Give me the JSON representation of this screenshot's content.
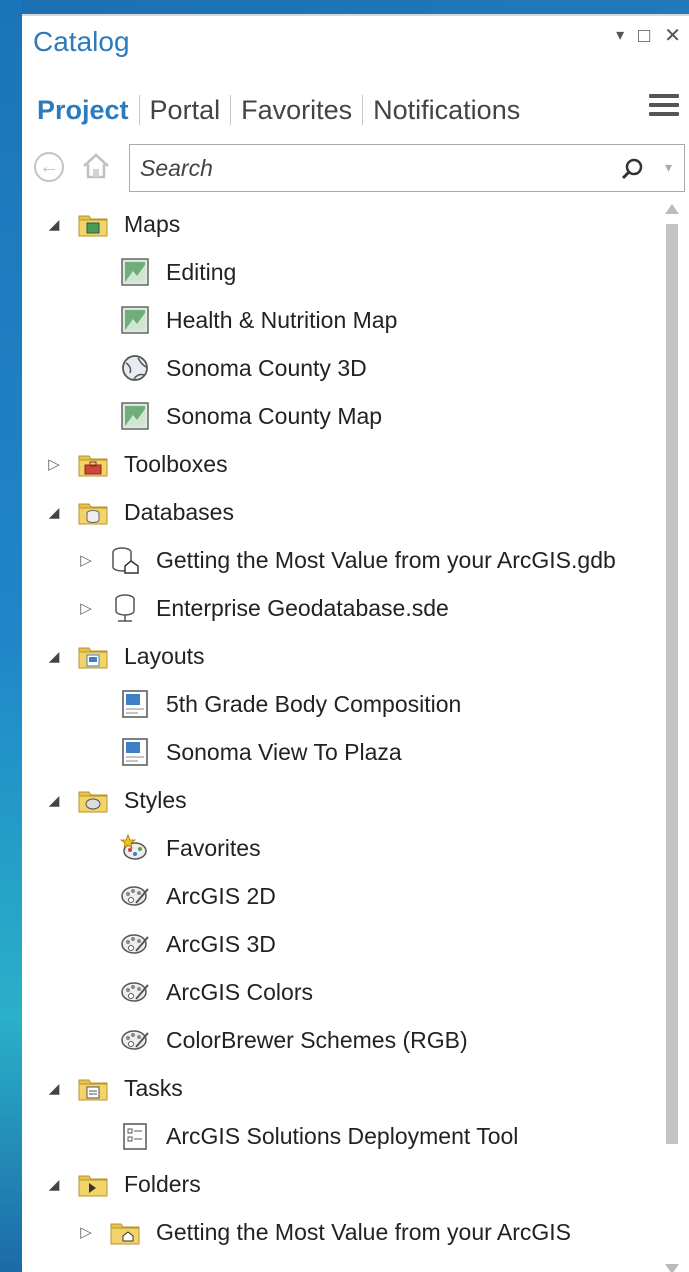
{
  "panel": {
    "title": "Catalog",
    "controls": {
      "dropdown": "▾",
      "maximize": "□",
      "close": "✕"
    }
  },
  "tabs": [
    {
      "label": "Project",
      "active": true
    },
    {
      "label": "Portal",
      "active": false
    },
    {
      "label": "Favorites",
      "active": false
    },
    {
      "label": "Notifications",
      "active": false
    }
  ],
  "search": {
    "placeholder": "Search",
    "value": ""
  },
  "colors": {
    "accent": "#2b7bbd",
    "folder": "#e8c34a",
    "map_green": "#4a9a5a",
    "toolbox_red": "#d0453a",
    "layout_blue": "#3f7fc7"
  },
  "tree": [
    {
      "label": "Maps",
      "level": 0,
      "state": "expanded",
      "icon": "folder-maps-icon"
    },
    {
      "label": "Editing",
      "level": 1,
      "state": "none",
      "icon": "map-icon"
    },
    {
      "label": "Health & Nutrition Map",
      "level": 1,
      "state": "none",
      "icon": "map-icon"
    },
    {
      "label": "Sonoma County 3D",
      "level": 1,
      "state": "none",
      "icon": "globe-scene-icon"
    },
    {
      "label": "Sonoma County Map",
      "level": 1,
      "state": "none",
      "icon": "map-icon"
    },
    {
      "label": "Toolboxes",
      "level": 0,
      "state": "collapsed",
      "icon": "folder-toolbox-icon"
    },
    {
      "label": "Databases",
      "level": 0,
      "state": "expanded",
      "icon": "folder-database-icon"
    },
    {
      "label": "Getting the Most Value from your ArcGIS.gdb",
      "level": 1,
      "state": "collapsed",
      "icon": "geodatabase-home-icon"
    },
    {
      "label": "Enterprise Geodatabase.sde",
      "level": 1,
      "state": "collapsed",
      "icon": "database-connection-icon"
    },
    {
      "label": "Layouts",
      "level": 0,
      "state": "expanded",
      "icon": "folder-layouts-icon"
    },
    {
      "label": "5th Grade Body Composition",
      "level": 1,
      "state": "none",
      "icon": "layout-icon"
    },
    {
      "label": "Sonoma View To Plaza",
      "level": 1,
      "state": "none",
      "icon": "layout-icon"
    },
    {
      "label": "Styles",
      "level": 0,
      "state": "expanded",
      "icon": "folder-styles-icon"
    },
    {
      "label": "Favorites",
      "level": 1,
      "state": "none",
      "icon": "style-favorites-icon"
    },
    {
      "label": "ArcGIS 2D",
      "level": 1,
      "state": "none",
      "icon": "style-palette-icon"
    },
    {
      "label": "ArcGIS 3D",
      "level": 1,
      "state": "none",
      "icon": "style-palette-icon"
    },
    {
      "label": "ArcGIS Colors",
      "level": 1,
      "state": "none",
      "icon": "style-palette-icon"
    },
    {
      "label": "ColorBrewer Schemes (RGB)",
      "level": 1,
      "state": "none",
      "icon": "style-palette-icon"
    },
    {
      "label": "Tasks",
      "level": 0,
      "state": "expanded",
      "icon": "folder-tasks-icon"
    },
    {
      "label": "ArcGIS Solutions Deployment Tool",
      "level": 1,
      "state": "none",
      "icon": "task-icon"
    },
    {
      "label": "Folders",
      "level": 0,
      "state": "expanded",
      "icon": "folder-folders-icon"
    },
    {
      "label": "Getting the Most Value from your ArcGIS",
      "level": 1,
      "state": "collapsed",
      "icon": "folder-home-icon"
    }
  ]
}
